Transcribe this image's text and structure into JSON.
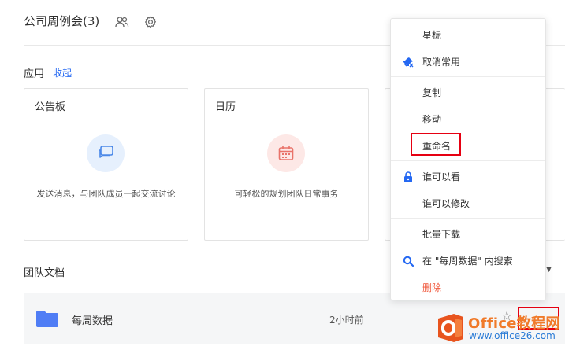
{
  "header": {
    "title": "公司周例会(3)"
  },
  "apps": {
    "label": "应用",
    "collapse": "收起",
    "cards": [
      {
        "title": "公告板",
        "desc": "发送消息，与团队成员一起交流讨论"
      },
      {
        "title": "日历",
        "desc": "可轻松的规划团队日常事务"
      }
    ]
  },
  "docs": {
    "label": "团队文档",
    "rows": [
      {
        "name": "每周数据",
        "time": "2小时前"
      }
    ]
  },
  "menu": {
    "items": [
      {
        "label": "星标"
      },
      {
        "label": "取消常用"
      },
      {
        "label": "复制"
      },
      {
        "label": "移动"
      },
      {
        "label": "重命名"
      },
      {
        "label": "谁可以看"
      },
      {
        "label": "谁可以修改"
      },
      {
        "label": "批量下载"
      },
      {
        "label": "在 \"每周数据\" 内搜索"
      },
      {
        "label": "删除"
      }
    ]
  },
  "watermark": {
    "brand": "Office教程网",
    "url": "www.office26.com"
  },
  "colors": {
    "accent": "#2468f2",
    "danger": "#f0573b",
    "highlight": "#e60012",
    "folder": "#4f7df5"
  }
}
